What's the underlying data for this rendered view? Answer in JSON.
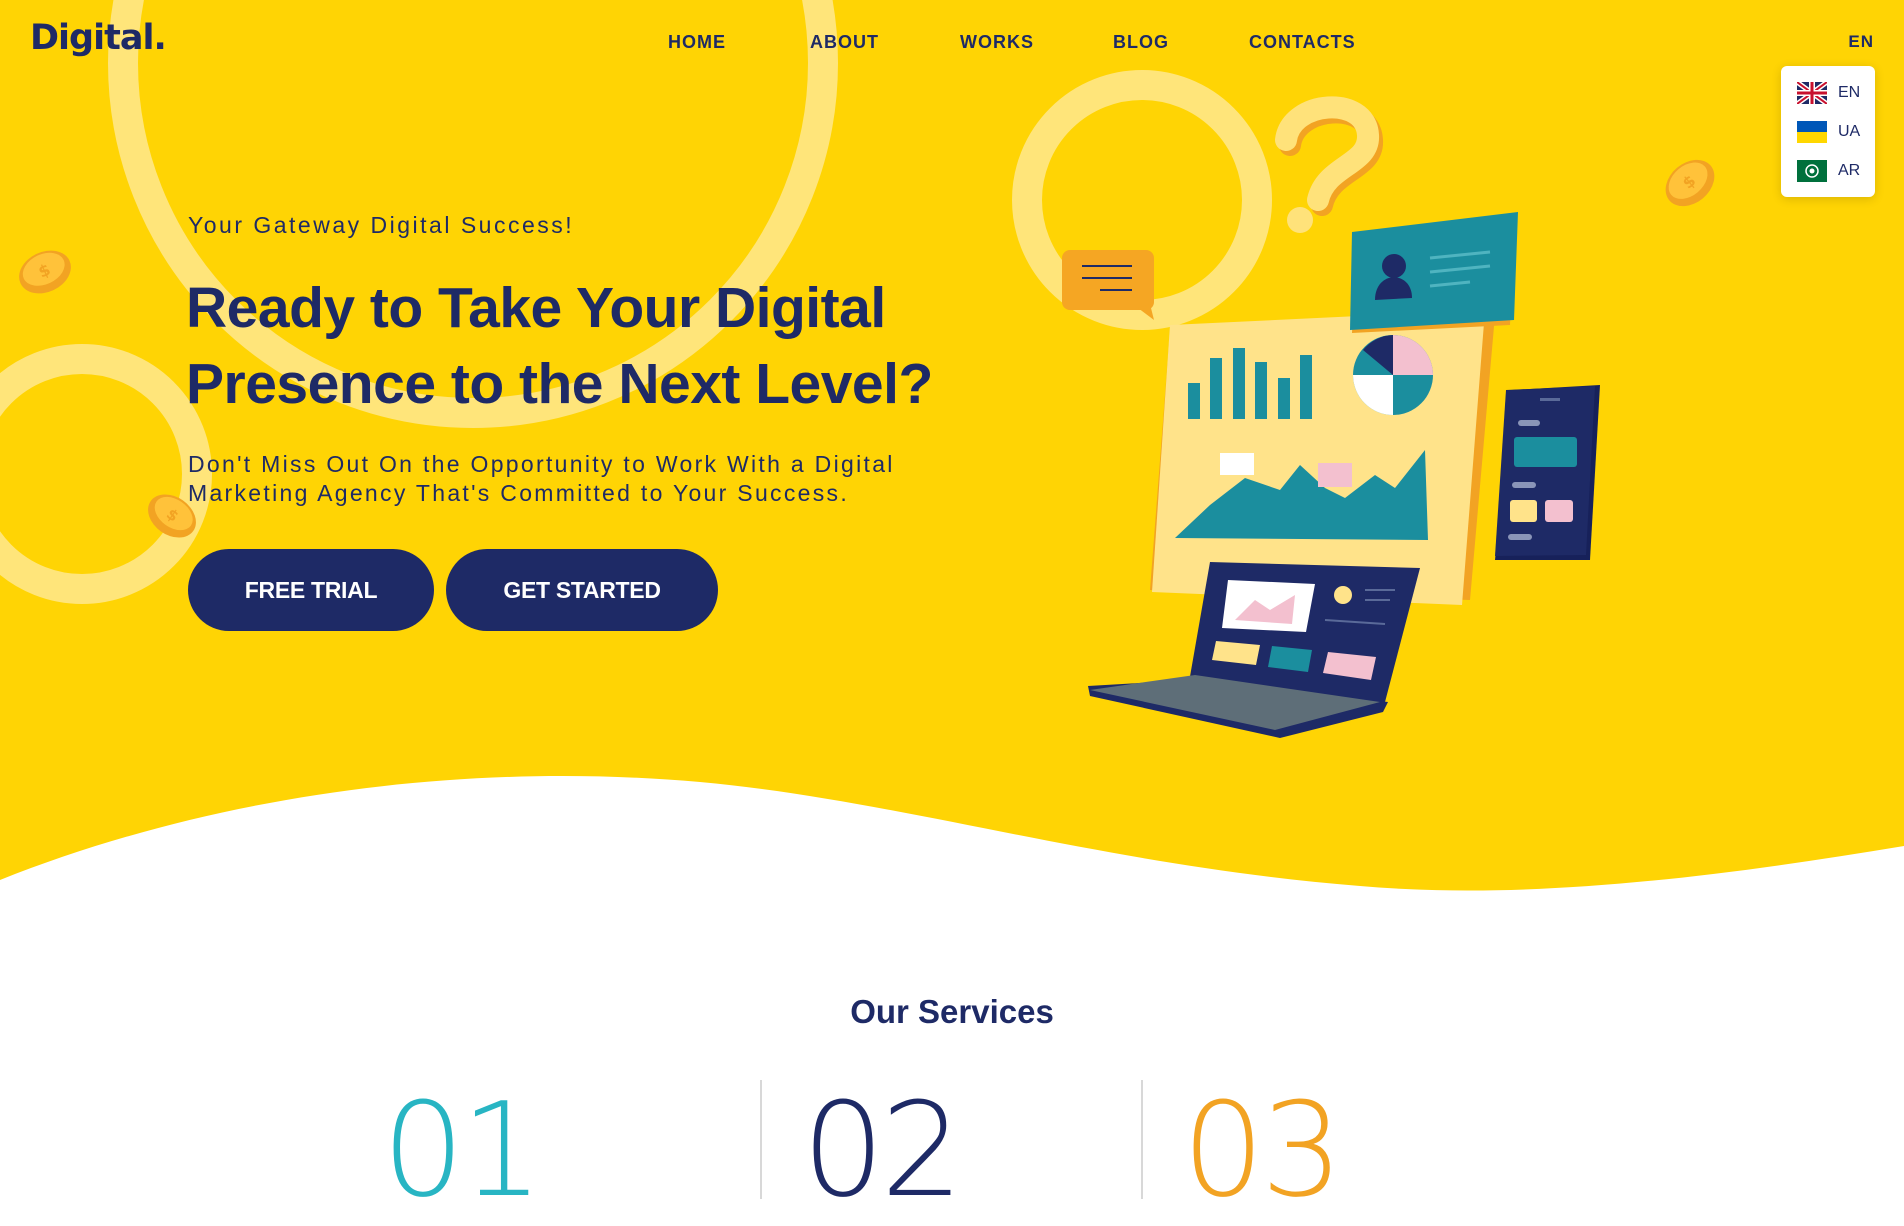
{
  "colors": {
    "brand_yellow": "#ffd404",
    "navy": "#1e2a66",
    "teal": "#1b8e9e",
    "orange": "#f2a323",
    "pink": "#f3c0cf"
  },
  "header": {
    "logo": "Digital.",
    "nav": [
      {
        "label": "HOME"
      },
      {
        "label": "ABOUT"
      },
      {
        "label": "WORKS"
      },
      {
        "label": "BLOG"
      },
      {
        "label": "CONTACTS"
      }
    ],
    "language": {
      "current": "EN",
      "options": [
        {
          "code": "EN",
          "flag": "uk-flag-icon"
        },
        {
          "code": "UA",
          "flag": "ua-flag-icon"
        },
        {
          "code": "AR",
          "flag": "arab-league-flag-icon"
        }
      ]
    }
  },
  "hero": {
    "tagline": "Your Gateway Digital Success!",
    "headline": "Ready to Take Your Digital Presence to the Next Level?",
    "subtext": "Don't Miss Out On the Opportunity to Work With a Digital Marketing Agency That's Committed to Your Success.",
    "buttons": {
      "free_trial": "FREE TRIAL",
      "get_started": "GET STARTED"
    },
    "illustration_icons": [
      "question-mark-icon",
      "chat-bubble-icon",
      "user-card-icon",
      "dashboard-chart-icon",
      "pie-chart-icon",
      "smartphone-icon",
      "laptop-icon",
      "coin-icon"
    ]
  },
  "services": {
    "title": "Our Services",
    "numbers": [
      {
        "label": "01",
        "color": "#28b5c3"
      },
      {
        "label": "02",
        "color": "#1e2a66"
      },
      {
        "label": "03",
        "color": "#f2a323"
      }
    ]
  }
}
